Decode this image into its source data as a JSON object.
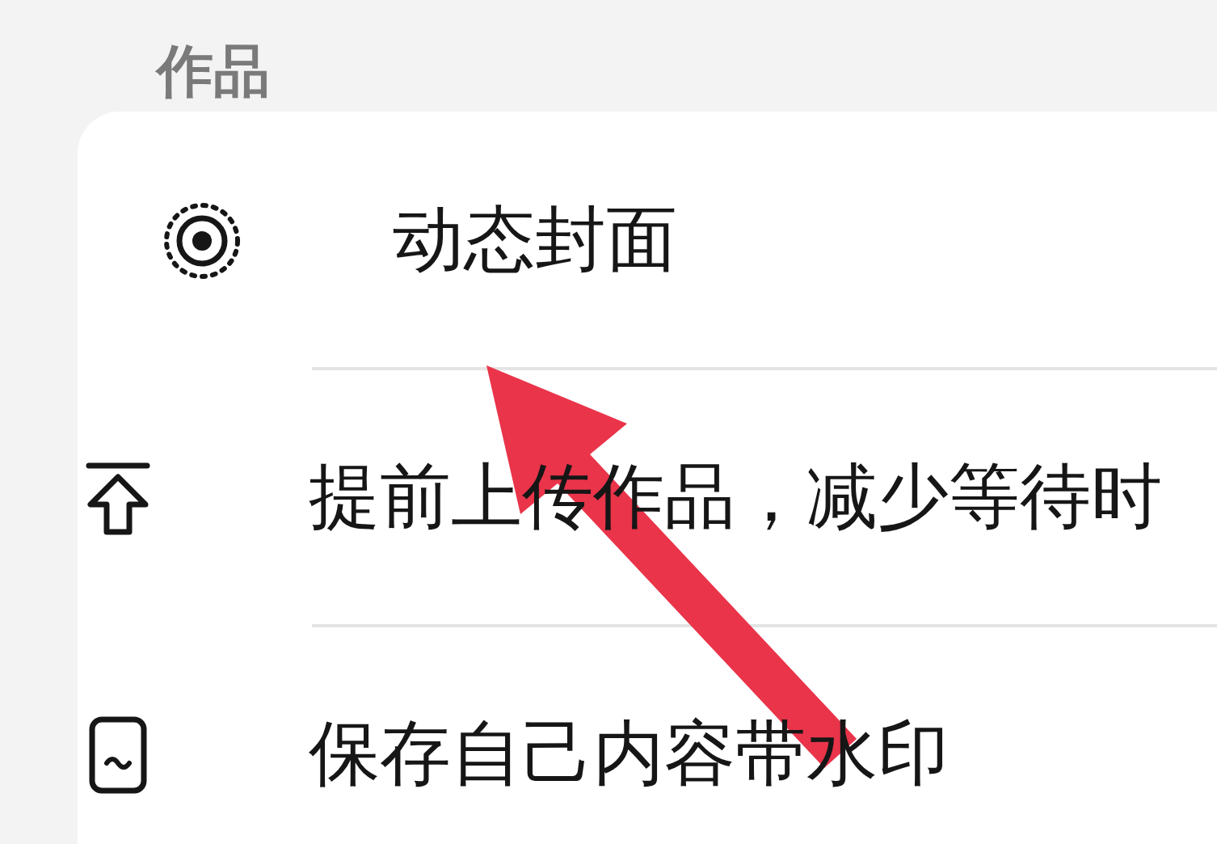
{
  "section_title": "作品",
  "items": [
    {
      "kind": "cover",
      "label": "动态封面"
    },
    {
      "kind": "upload",
      "label": "提前上传作品，减少等待时"
    },
    {
      "kind": "watermark",
      "label": "保存自己内容带水印"
    }
  ]
}
